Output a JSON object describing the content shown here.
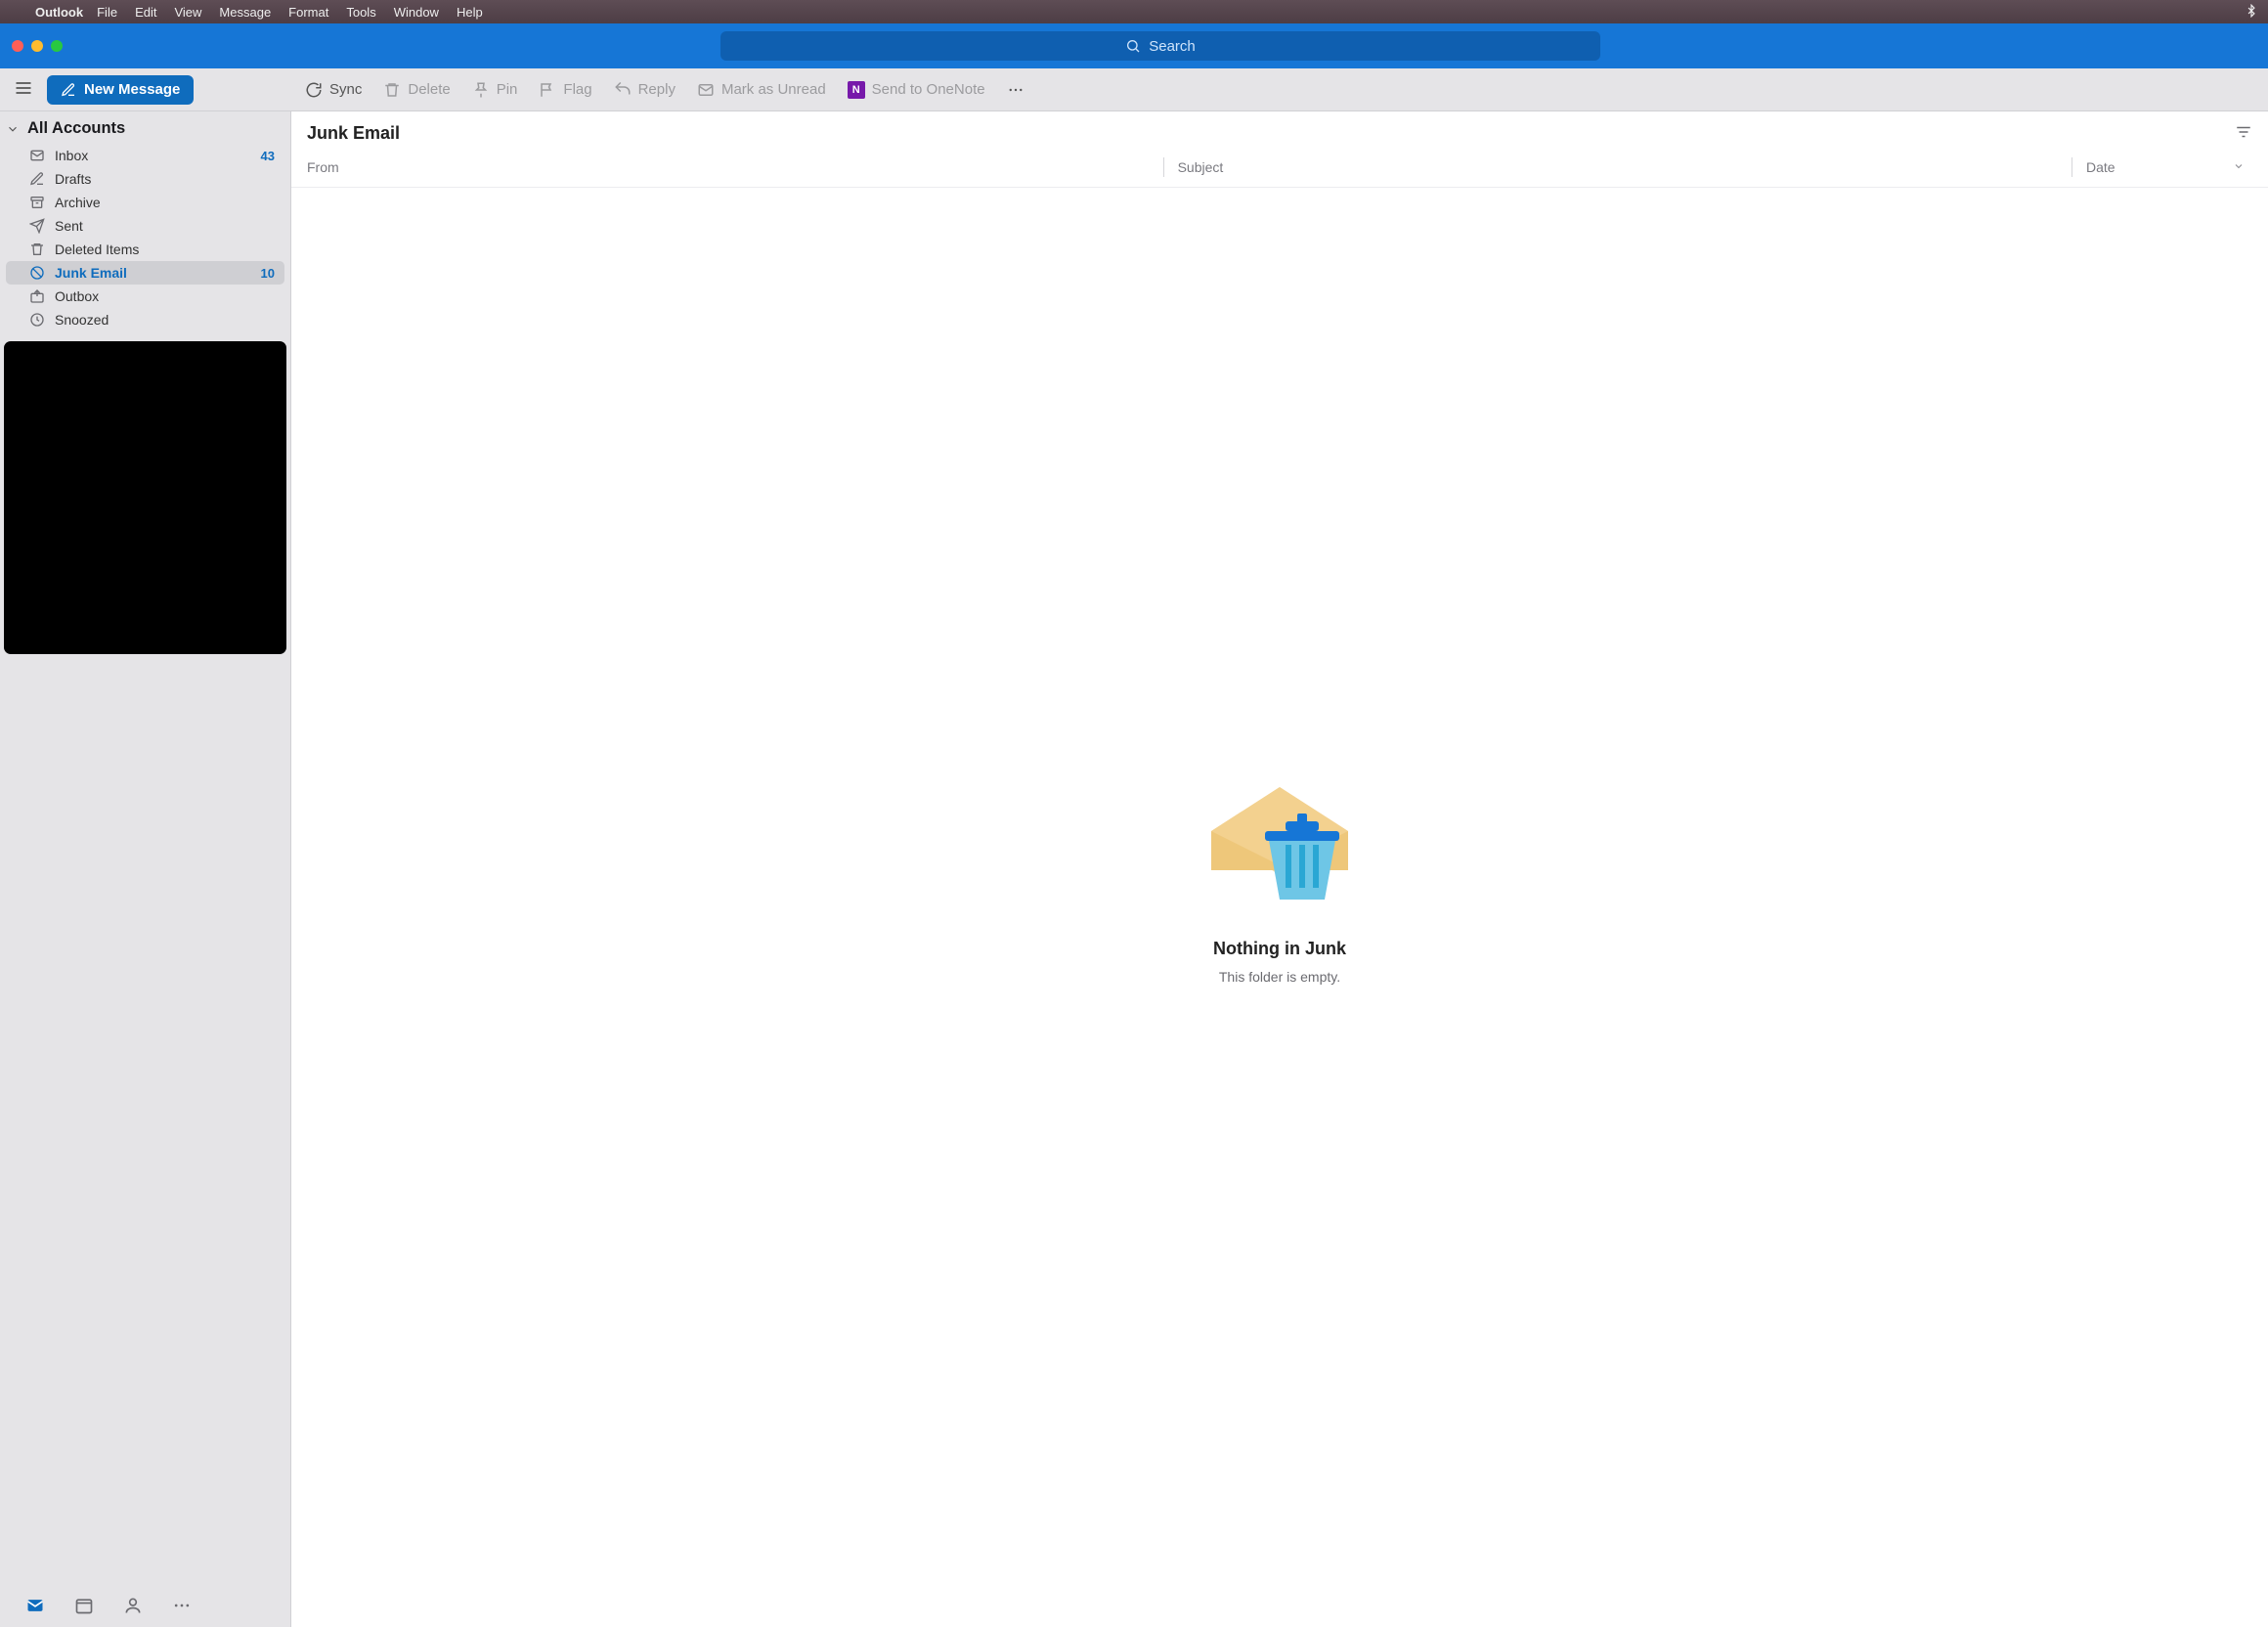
{
  "menubar": {
    "app": "Outlook",
    "items": [
      "File",
      "Edit",
      "View",
      "Message",
      "Format",
      "Tools",
      "Window",
      "Help"
    ]
  },
  "search": {
    "placeholder": "Search"
  },
  "new_message": {
    "label": "New Message"
  },
  "ribbon": {
    "sync": "Sync",
    "delete": "Delete",
    "pin": "Pin",
    "flag": "Flag",
    "reply": "Reply",
    "mark_unread": "Mark as Unread",
    "send_onenote": "Send to OneNote"
  },
  "accounts_header": "All Accounts",
  "folders": [
    {
      "key": "inbox",
      "label": "Inbox",
      "count": "43",
      "selected": false
    },
    {
      "key": "drafts",
      "label": "Drafts",
      "count": "",
      "selected": false
    },
    {
      "key": "archive",
      "label": "Archive",
      "count": "",
      "selected": false
    },
    {
      "key": "sent",
      "label": "Sent",
      "count": "",
      "selected": false
    },
    {
      "key": "deleted",
      "label": "Deleted Items",
      "count": "",
      "selected": false
    },
    {
      "key": "junk",
      "label": "Junk Email",
      "count": "10",
      "selected": true
    },
    {
      "key": "outbox",
      "label": "Outbox",
      "count": "",
      "selected": false
    },
    {
      "key": "snoozed",
      "label": "Snoozed",
      "count": "",
      "selected": false
    }
  ],
  "content": {
    "title": "Junk Email",
    "columns": {
      "from": "From",
      "subject": "Subject",
      "date": "Date"
    },
    "empty_title": "Nothing in Junk",
    "empty_sub": "This folder is empty."
  },
  "colors": {
    "accent": "#0f6cbd",
    "header": "#1676d6"
  }
}
